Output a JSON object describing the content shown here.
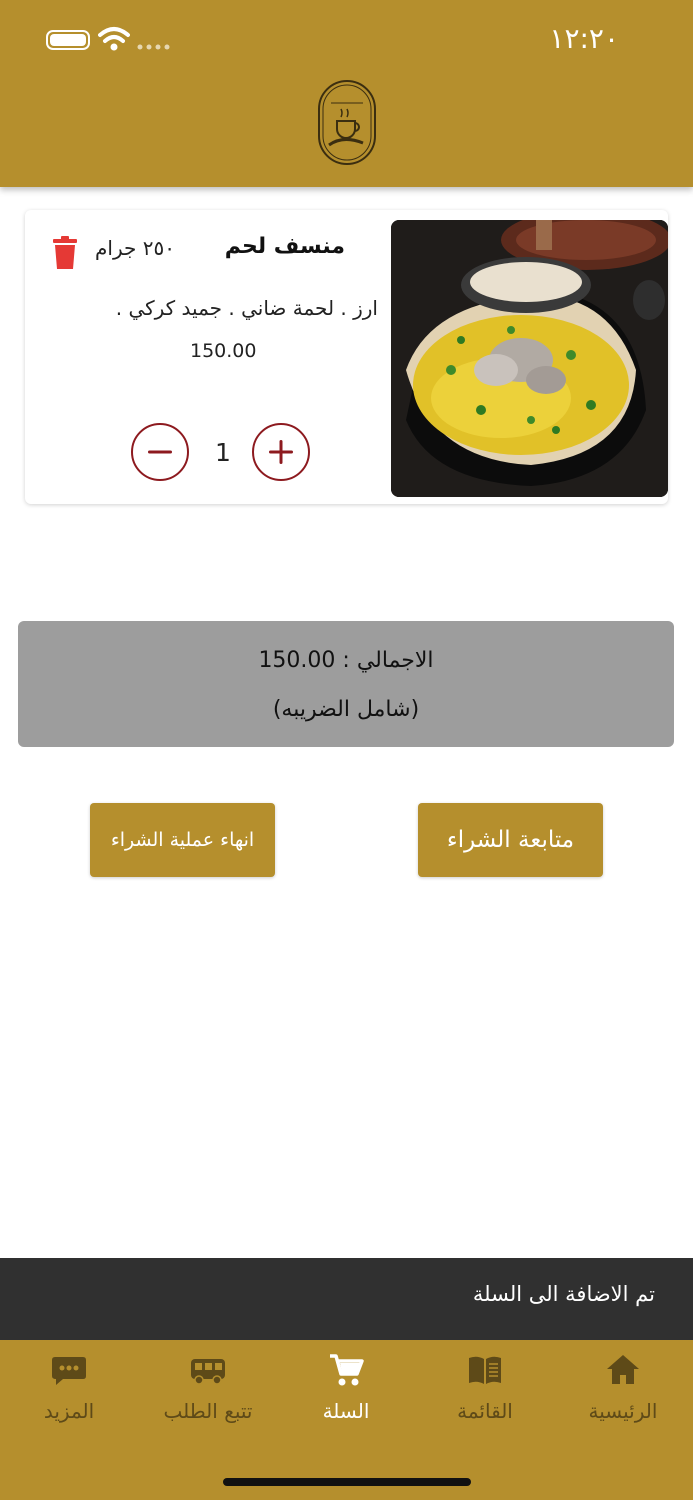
{
  "status_bar": {
    "time": "١٢:٢٠"
  },
  "item": {
    "name": "منسف لحم",
    "weight": "٢٥٠ جرام",
    "description": "ارز . لحمة ضاني . جميد كركي .",
    "price": "150.00",
    "quantity": "1"
  },
  "summary": {
    "total": "الاجمالي : 150.00",
    "tax_note": "(شامل الضريبه)"
  },
  "actions": {
    "continue_label": "متابعة الشراء",
    "finish_label": "انهاء عملية الشراء"
  },
  "snackbar": {
    "message": "تم الاضافة الى السلة"
  },
  "nav": {
    "items": [
      {
        "label": "الرئيسية",
        "icon": "home-icon"
      },
      {
        "label": "القائمة",
        "icon": "menu-book-icon"
      },
      {
        "label": "السلة",
        "icon": "cart-icon"
      },
      {
        "label": "تتبع الطلب",
        "icon": "truck-icon"
      },
      {
        "label": "المزيد",
        "icon": "more-icon"
      }
    ],
    "active_index": 2
  },
  "colors": {
    "brand": "#b58f2d",
    "accent": "#8d1a1f",
    "delete": "#e53935",
    "snackbar": "#303030",
    "total_bg": "#9d9d9d"
  }
}
